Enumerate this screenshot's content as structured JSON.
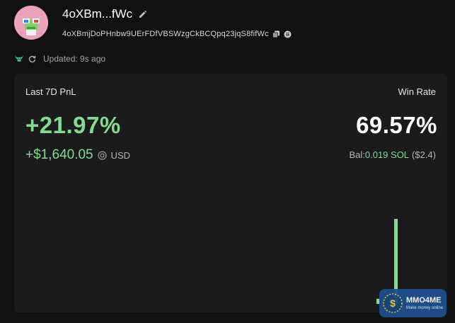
{
  "profile": {
    "name": "4oXBm...fWc",
    "address": "4oXBmjDoPHnbw9UErFDfVBSWzgCkBCQpq23jqS8fifWc",
    "updated": "Updated: 9s ago"
  },
  "stats": {
    "pnl_label": "Last 7D PnL",
    "win_rate_label": "Win Rate",
    "pnl_percent": "+21.97%",
    "win_rate": "69.57%",
    "pnl_amount": "+$1,640.05",
    "currency": "USD",
    "balance_label": "Bal:",
    "balance_value": "0.019 SOL",
    "balance_usd": "($2.4)"
  },
  "colors": {
    "positive": "#86d993",
    "card_bg": "#1b1b1c",
    "page_bg": "#111111"
  },
  "icons": {
    "edit": "pencil-icon",
    "copy": "copy-icon",
    "explorer": "explorer-icon",
    "refresh": "refresh-icon",
    "bull": "bull-icon",
    "currency": "currency-icon"
  },
  "chart_data": {
    "type": "bar",
    "bars": [
      {
        "value": 0.06,
        "color": "#86d993"
      },
      {
        "value": 1.0,
        "color": "#86d993"
      },
      {
        "value": 0.06,
        "color": "#7a7690"
      }
    ]
  },
  "watermark": {
    "title": "MMO4ME",
    "subtitle": "Make money online"
  }
}
